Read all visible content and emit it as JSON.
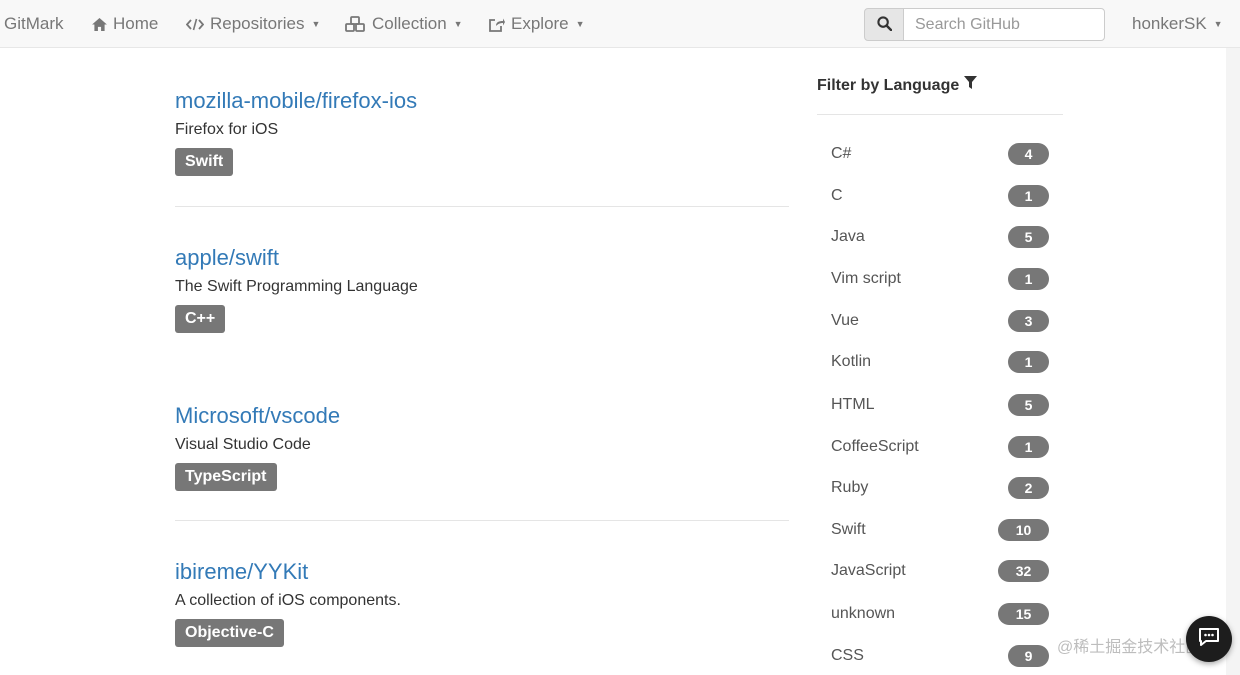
{
  "navbar": {
    "brand": "GitMark",
    "home": "Home",
    "repositories": "Repositories",
    "collection": "Collection",
    "explore": "Explore",
    "search_placeholder": "Search GitHub",
    "user": "honkerSK",
    "icons": [
      "home-icon",
      "code-icon",
      "cubes-icon",
      "share-square-icon",
      "search-icon",
      "caret-down-icon"
    ]
  },
  "repos": [
    {
      "name": "mozilla-mobile/firefox-ios",
      "description": "Firefox for iOS",
      "language": "Swift"
    },
    {
      "name": "apple/swift",
      "description": "The Swift Programming Language",
      "language": "C++"
    },
    {
      "name": "Microsoft/vscode",
      "description": "Visual Studio Code",
      "language": "TypeScript"
    },
    {
      "name": "ibireme/YYKit",
      "description": "A collection of iOS components.",
      "language": "Objective-C"
    }
  ],
  "filter": {
    "title": "Filter by Language",
    "icon": "filter-icon",
    "languages": [
      {
        "name": "C#",
        "count": "4"
      },
      {
        "name": "C",
        "count": "1"
      },
      {
        "name": "Java",
        "count": "5"
      },
      {
        "name": "Vim script",
        "count": "1"
      },
      {
        "name": "Vue",
        "count": "3"
      },
      {
        "name": "Kotlin",
        "count": "1"
      },
      {
        "name": "HTML",
        "count": "5"
      },
      {
        "name": "CoffeeScript",
        "count": "1"
      },
      {
        "name": "Ruby",
        "count": "2"
      },
      {
        "name": "Swift",
        "count": "10"
      },
      {
        "name": "JavaScript",
        "count": "32"
      },
      {
        "name": "unknown",
        "count": "15"
      },
      {
        "name": "CSS",
        "count": "9"
      }
    ]
  },
  "watermark": "@稀土掘金技术社区",
  "colors": {
    "link": "#337ab7",
    "badge": "#777777",
    "navbar_bg": "#f8f8f8"
  }
}
